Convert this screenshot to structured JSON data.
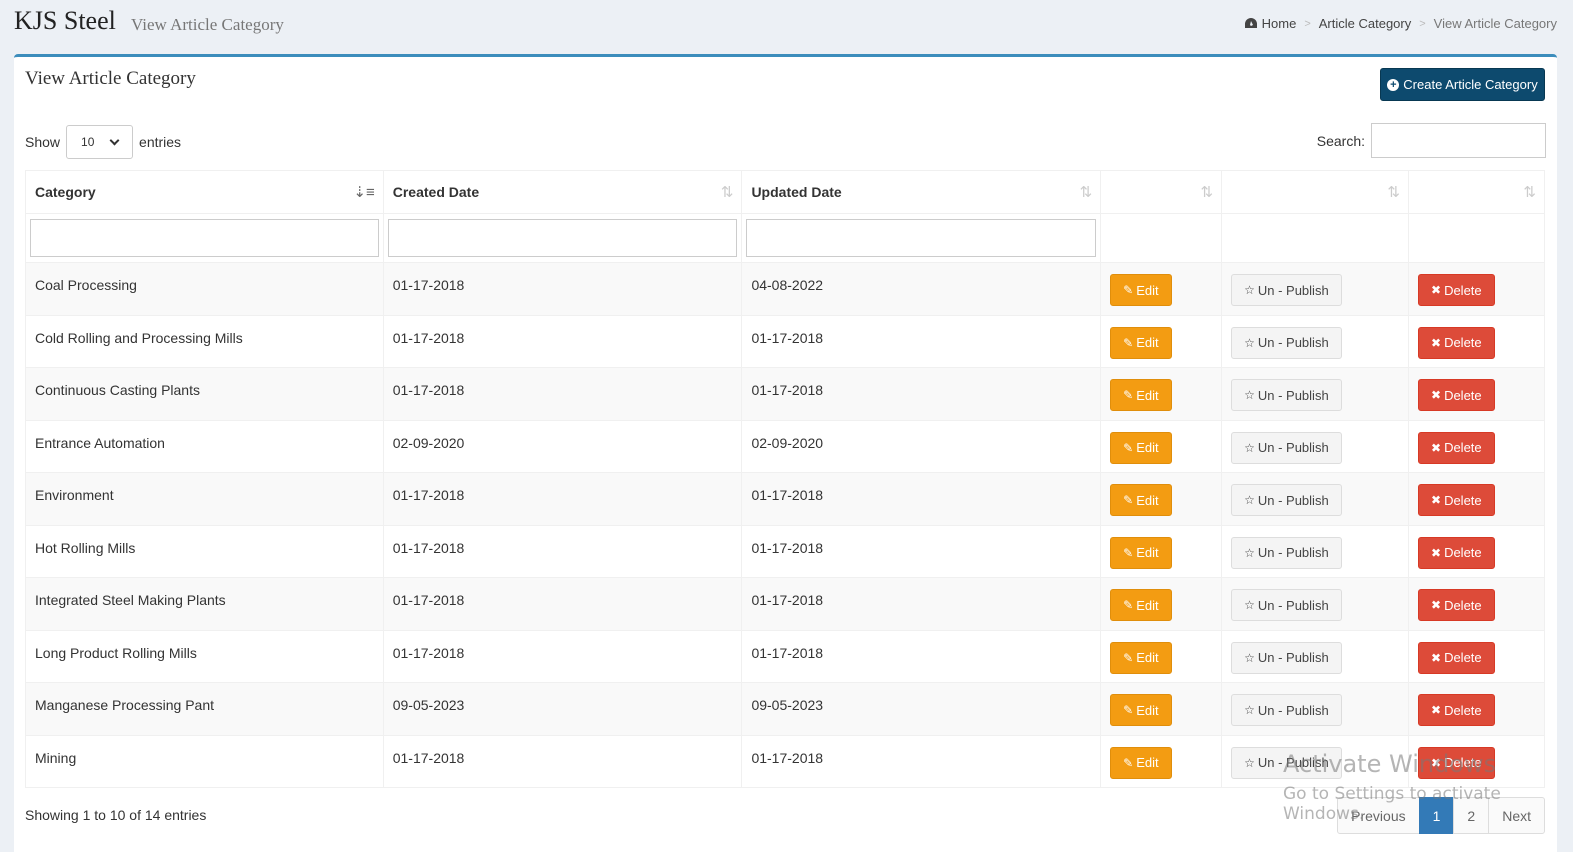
{
  "header": {
    "brand": "KJS Steel",
    "subtitle": "View Article Category",
    "breadcrumb": [
      "Home",
      "Article Category",
      "View Article Category"
    ]
  },
  "box": {
    "title": "View Article Category",
    "create_label": "Create Article Category"
  },
  "controls": {
    "show_label": "Show",
    "entries_value": "10",
    "entries_label": "entries",
    "search_label": "Search:"
  },
  "table": {
    "columns": [
      "Category",
      "Created Date",
      "Updated Date"
    ],
    "rows": [
      {
        "category": "Coal Processing",
        "created": "01-17-2018",
        "updated": "04-08-2022"
      },
      {
        "category": "Cold Rolling and Processing Mills",
        "created": "01-17-2018",
        "updated": "01-17-2018"
      },
      {
        "category": "Continuous Casting Plants",
        "created": "01-17-2018",
        "updated": "01-17-2018"
      },
      {
        "category": "Entrance Automation",
        "created": "02-09-2020",
        "updated": "02-09-2020"
      },
      {
        "category": "Environment",
        "created": "01-17-2018",
        "updated": "01-17-2018"
      },
      {
        "category": "Hot Rolling Mills",
        "created": "01-17-2018",
        "updated": "01-17-2018"
      },
      {
        "category": "Integrated Steel Making Plants",
        "created": "01-17-2018",
        "updated": "01-17-2018"
      },
      {
        "category": "Long Product Rolling Mills",
        "created": "01-17-2018",
        "updated": "01-17-2018"
      },
      {
        "category": "Manganese Processing Pant",
        "created": "09-05-2023",
        "updated": "09-05-2023"
      },
      {
        "category": "Mining",
        "created": "01-17-2018",
        "updated": "01-17-2018"
      }
    ],
    "edit_label": "Edit",
    "unpublish_label": "Un - Publish",
    "delete_label": "Delete"
  },
  "footer": {
    "info": "Showing 1 to 10 of 14 entries",
    "pages": [
      "Previous",
      "1",
      "2",
      "Next"
    ]
  },
  "watermark": {
    "line1": "Activate Windows",
    "line2": "Go to Settings to activate Windows."
  },
  "colors": {
    "accent": "#3c8dbc",
    "create_button": "#0d4a6e",
    "edit_button": "#f39c12",
    "delete_button": "#dd4b39",
    "active_page": "#337ab7"
  }
}
